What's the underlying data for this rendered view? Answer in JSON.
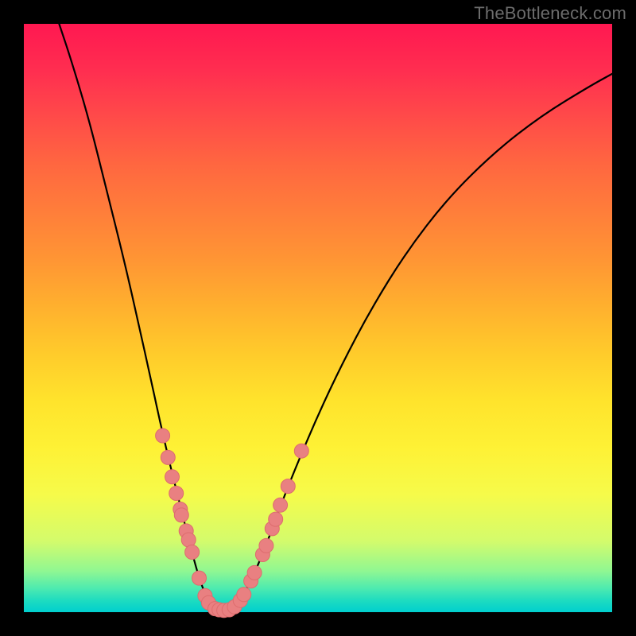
{
  "watermark": "TheBottleneck.com",
  "colors": {
    "dot_fill": "#e98081",
    "dot_stroke": "#dd6c6e",
    "curve": "#000000",
    "frame": "#000000"
  },
  "chart_data": {
    "type": "line",
    "title": "",
    "xlabel": "",
    "ylabel": "",
    "xlim": [
      0,
      100
    ],
    "ylim": [
      0,
      100
    ],
    "grid": false,
    "curve_points_percent": [
      [
        6.0,
        100.0
      ],
      [
        8.0,
        94.0
      ],
      [
        11.0,
        84.0
      ],
      [
        14.0,
        72.0
      ],
      [
        17.0,
        60.0
      ],
      [
        19.5,
        49.0
      ],
      [
        21.5,
        40.0
      ],
      [
        23.0,
        33.0
      ],
      [
        24.5,
        26.5
      ],
      [
        26.0,
        20.5
      ],
      [
        27.3,
        15.2
      ],
      [
        28.5,
        10.5
      ],
      [
        29.5,
        6.8
      ],
      [
        30.5,
        3.8
      ],
      [
        31.5,
        1.8
      ],
      [
        32.7,
        0.6
      ],
      [
        34.0,
        0.3
      ],
      [
        35.2,
        0.6
      ],
      [
        36.5,
        1.8
      ],
      [
        38.2,
        4.5
      ],
      [
        39.8,
        8.0
      ],
      [
        41.8,
        13.0
      ],
      [
        43.8,
        18.5
      ],
      [
        46.5,
        25.3
      ],
      [
        50.0,
        33.5
      ],
      [
        54.0,
        42.0
      ],
      [
        59.0,
        51.5
      ],
      [
        65.0,
        61.2
      ],
      [
        72.0,
        70.3
      ],
      [
        80.0,
        78.2
      ],
      [
        88.0,
        84.4
      ],
      [
        96.0,
        89.3
      ],
      [
        100.0,
        91.5
      ]
    ],
    "dots_percent": [
      [
        23.6,
        30.0
      ],
      [
        24.5,
        26.3
      ],
      [
        25.2,
        23.0
      ],
      [
        25.9,
        20.2
      ],
      [
        26.6,
        17.5
      ],
      [
        26.8,
        16.5
      ],
      [
        27.6,
        13.8
      ],
      [
        28.0,
        12.3
      ],
      [
        28.6,
        10.2
      ],
      [
        29.8,
        5.8
      ],
      [
        30.8,
        2.8
      ],
      [
        31.4,
        1.6
      ],
      [
        32.5,
        0.6
      ],
      [
        33.2,
        0.4
      ],
      [
        34.0,
        0.3
      ],
      [
        34.9,
        0.4
      ],
      [
        35.8,
        0.9
      ],
      [
        36.8,
        2.0
      ],
      [
        37.4,
        3.0
      ],
      [
        38.6,
        5.3
      ],
      [
        39.2,
        6.7
      ],
      [
        40.6,
        9.8
      ],
      [
        41.2,
        11.3
      ],
      [
        42.2,
        14.2
      ],
      [
        42.8,
        15.8
      ],
      [
        43.6,
        18.2
      ],
      [
        44.9,
        21.4
      ],
      [
        47.2,
        27.4
      ]
    ]
  }
}
